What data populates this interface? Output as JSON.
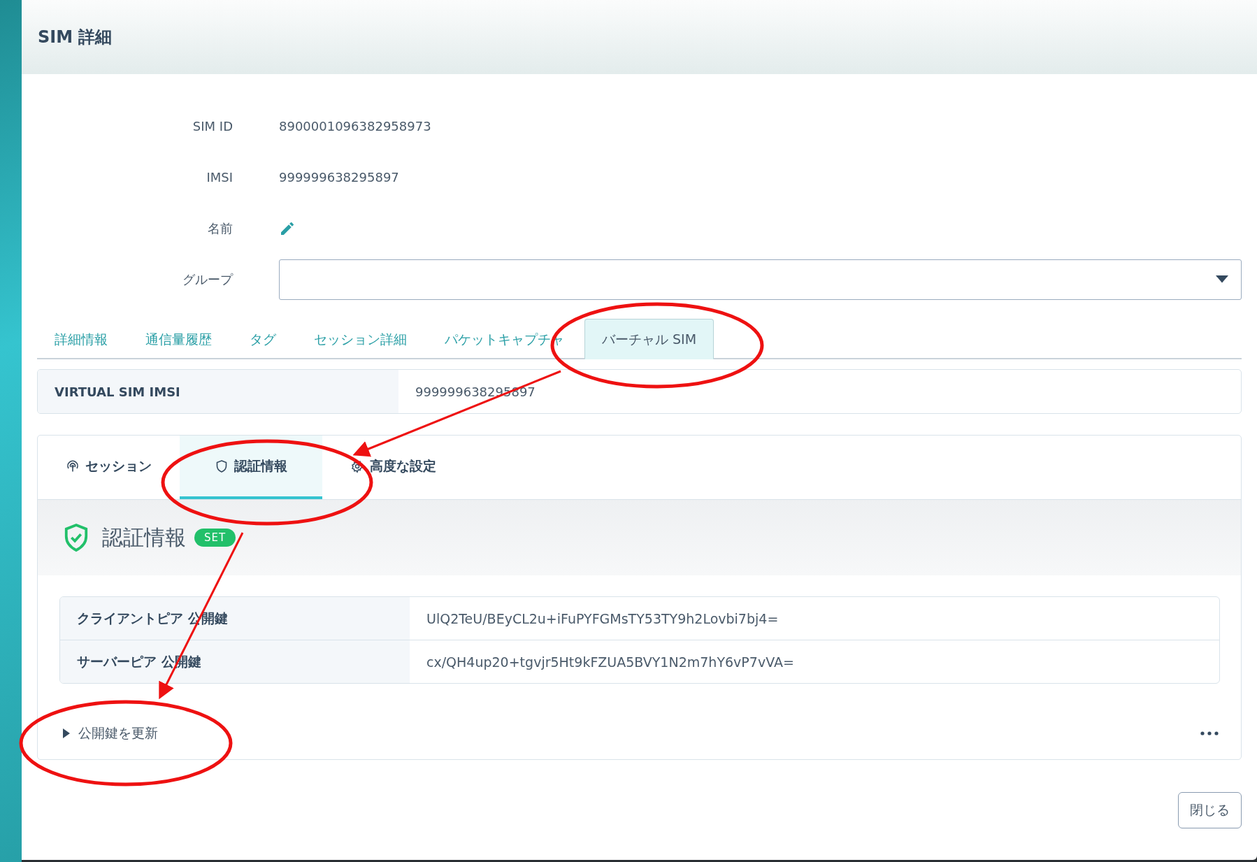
{
  "window": {
    "title": "SIM 詳細"
  },
  "fields": [
    {
      "label": "SIM ID",
      "kind": "text",
      "value": "8900001096382958973"
    },
    {
      "label": "IMSI",
      "kind": "text",
      "value": "999999638295897"
    },
    {
      "label": "名前",
      "kind": "edit"
    },
    {
      "label": "グループ",
      "kind": "select"
    }
  ],
  "tabs": [
    {
      "label": "詳細情報",
      "selected": false
    },
    {
      "label": "通信量履歴",
      "selected": false
    },
    {
      "label": "タグ",
      "selected": false
    },
    {
      "label": "セッション詳細",
      "selected": false
    },
    {
      "label": "パケットキャプチャ",
      "selected": false
    },
    {
      "label": "バーチャル SIM",
      "selected": true
    }
  ],
  "virtual_sim": {
    "label": "VIRTUAL SIM IMSI",
    "value": "999999638295897"
  },
  "subtabs": [
    {
      "label": "セッション",
      "kind": "session",
      "selected": false
    },
    {
      "label": "認証情報",
      "kind": "auth",
      "selected": true
    },
    {
      "label": "高度な設定",
      "kind": "settings",
      "selected": false
    }
  ],
  "auth": {
    "title": "認証情報",
    "badge": "SET",
    "keys": [
      {
        "label": "クライアントピア 公開鍵",
        "value": "UlQ2TeU/BEyCL2u+iFuPYFGMsTY53TY9h2Lovbi7bj4="
      },
      {
        "label": "サーバーピア 公開鍵",
        "value": "cx/QH4up20+tgvjr5Ht9kFZUA5BVY1N2m7hY6vP7vVA="
      }
    ],
    "expander": {
      "label": "公開鍵を更新",
      "expanded": false
    }
  },
  "buttons": [
    "閉じる"
  ]
}
